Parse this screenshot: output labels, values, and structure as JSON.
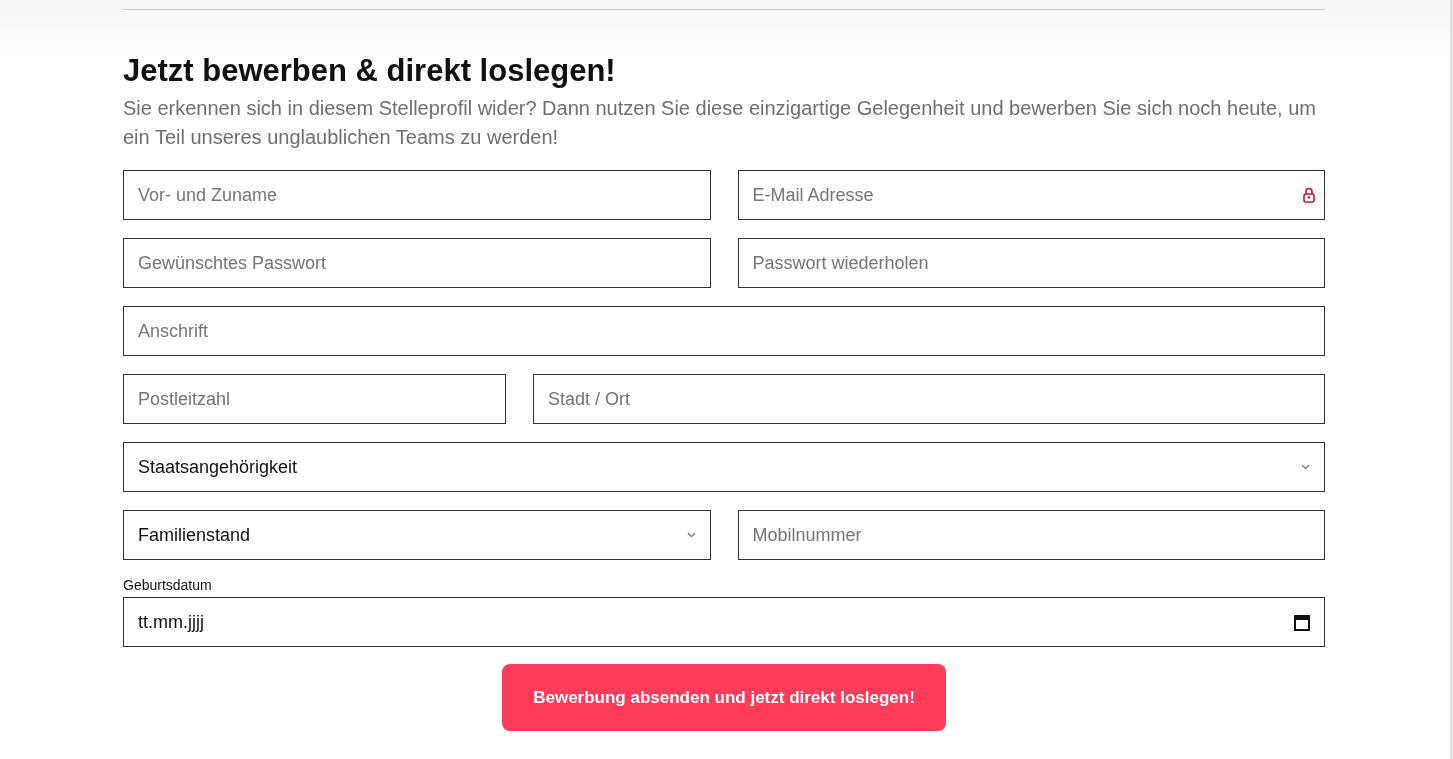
{
  "heading": "Jetzt bewerben & direkt loslegen!",
  "intro": "Sie erkennen sich in diesem Stelleprofil wider? Dann nutzen Sie diese einzigartige Gelegenheit und bewerben Sie sich noch heute, um ein Teil unseres unglaublichen Teams zu werden!",
  "rows": [
    {
      "kind": "pair",
      "fields": [
        {
          "kind": "input",
          "placeholder": "Vor- und Zuname"
        },
        {
          "kind": "input",
          "placeholder": "E-Mail Adresse",
          "lock_icon": true
        }
      ]
    },
    {
      "kind": "pair",
      "fields": [
        {
          "kind": "input",
          "placeholder": "Gewünschtes Passwort"
        },
        {
          "kind": "input",
          "placeholder": "Passwort wiederholen"
        }
      ]
    },
    {
      "kind": "full",
      "fields": [
        {
          "kind": "input",
          "placeholder": "Anschrift"
        }
      ]
    },
    {
      "kind": "zip-city",
      "fields": [
        {
          "kind": "input",
          "placeholder": "Postleitzahl"
        },
        {
          "kind": "input",
          "placeholder": "Stadt / Ort"
        }
      ]
    },
    {
      "kind": "full",
      "fields": [
        {
          "kind": "select",
          "value": "Staatsangehörigkeit"
        }
      ]
    },
    {
      "kind": "pair",
      "fields": [
        {
          "kind": "select",
          "value": "Familienstand"
        },
        {
          "kind": "input",
          "placeholder": "Mobilnummer"
        }
      ]
    },
    {
      "kind": "full",
      "fields": [
        {
          "kind": "date",
          "label": "Geburtsdatum",
          "value": "tt.mm.jjjj"
        }
      ]
    }
  ],
  "submit": "Bewerbung absenden und jetzt direkt loslegen!"
}
